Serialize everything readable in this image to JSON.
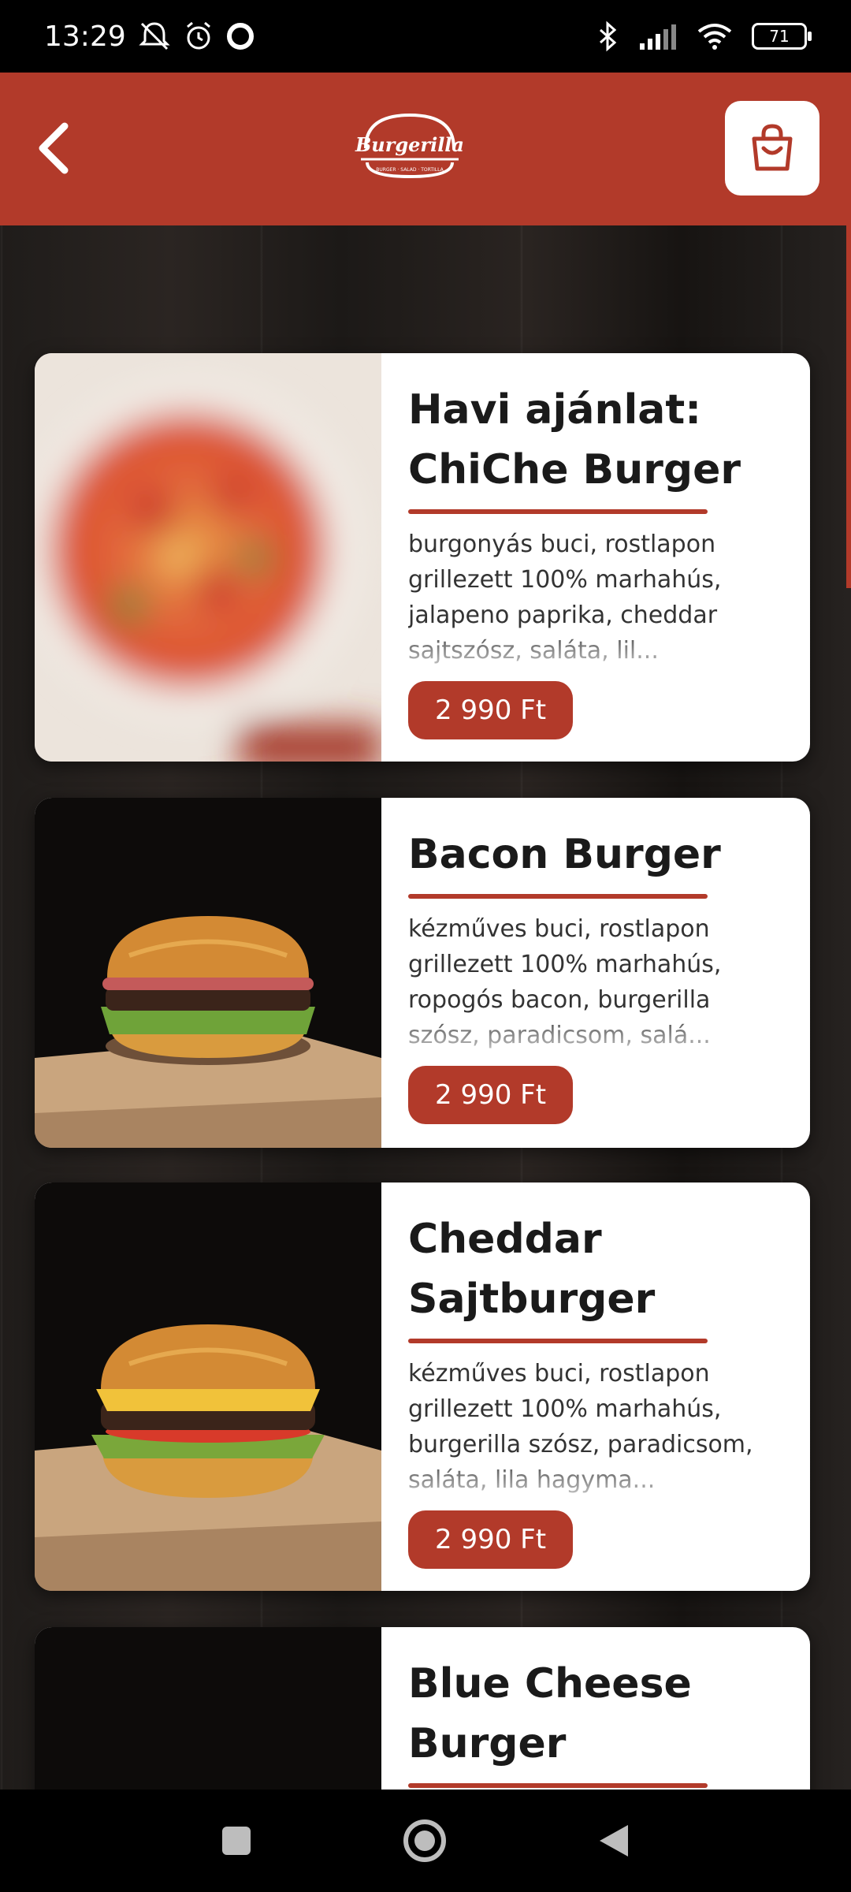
{
  "status_bar": {
    "time": "13:29",
    "battery": "71"
  },
  "header": {
    "logo_text": "Burgerilla",
    "logo_subtitle": "BURGER · SALAD · TORTILLA"
  },
  "menu_items": [
    {
      "title": "Havi ajánlat: ChiChe Burger",
      "description": "burgonyás buci, rostlapon grillezett 100% marhahús, jalapeno paprika, cheddar sajtszósz, saláta, lil...",
      "price": "2 990 Ft",
      "image": "blurred-pizza-image"
    },
    {
      "title": "Bacon Burger",
      "description": "kézműves buci, rostlapon grillezett 100% marhahús, ropogós bacon, burgerilla szósz, paradicsom, salá...",
      "price": "2 990 Ft",
      "image": "bacon-burger-image"
    },
    {
      "title": "Cheddar Sajtburger",
      "description": "kézműves buci, rostlapon grillezett 100% marhahús, burgerilla szósz, paradicsom, saláta, lila hagyma...",
      "price": "2 990 Ft",
      "image": "cheddar-burger-image"
    },
    {
      "title": "Blue Cheese Burger",
      "description": "",
      "price": "",
      "image": "blue-cheese-burger-image"
    }
  ],
  "colors": {
    "brand": "#b23a2a",
    "card": "#ffffff"
  }
}
